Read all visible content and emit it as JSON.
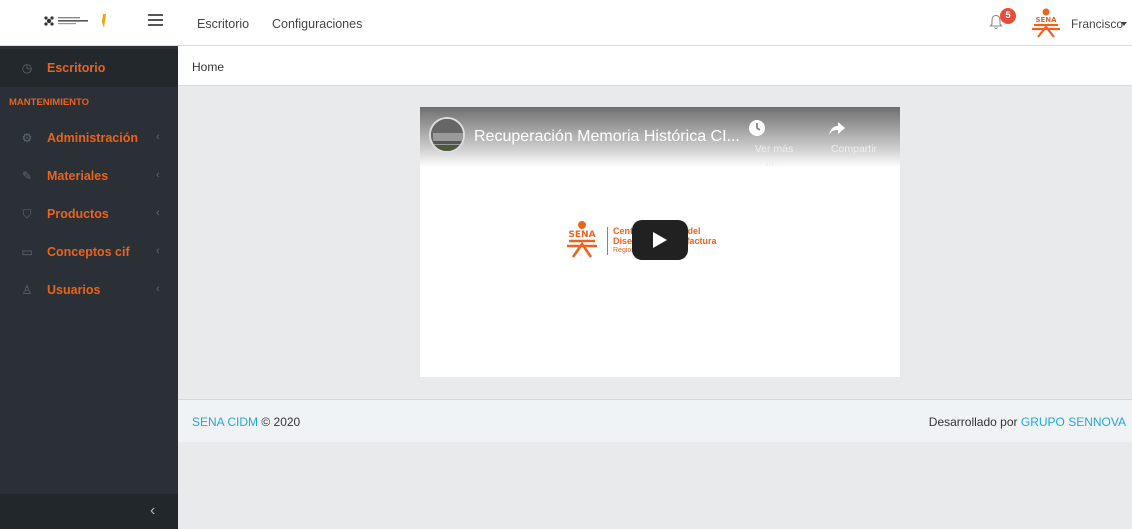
{
  "topbar": {
    "nav": [
      "Escritorio",
      "Configuraciones"
    ],
    "notification_count": "5",
    "user_name": "Francisco"
  },
  "sidebar": {
    "header": "MANTENIMIENTO",
    "items": [
      {
        "label": "Escritorio",
        "icon": "speedometer-icon"
      },
      {
        "label": "Administración",
        "icon": "gear-icon"
      },
      {
        "label": "Materiales",
        "icon": "wrench-icon"
      },
      {
        "label": "Productos",
        "icon": "cart-icon"
      },
      {
        "label": "Conceptos cif",
        "icon": "folder-icon"
      },
      {
        "label": "Usuarios",
        "icon": "user-icon"
      }
    ]
  },
  "breadcrumb": "Home",
  "video": {
    "title": "Recuperación Memoria Histórica CI...",
    "watch_later": "Ver más ta...",
    "share": "Compartir",
    "logo_line1": "Centro Industrial del",
    "logo_line2": "Diseño y la Manufactura",
    "logo_line3": "Regional Santander"
  },
  "footer": {
    "left_link": "SENA CIDM",
    "left_text": "© 2020",
    "right_text": "Desarrollado por",
    "right_link": "GRUPO SENNOVA"
  },
  "colors": {
    "accent": "#e8641f",
    "sidebar": "#2a3035",
    "link": "#20a8d8",
    "badge": "#e74c3c"
  }
}
